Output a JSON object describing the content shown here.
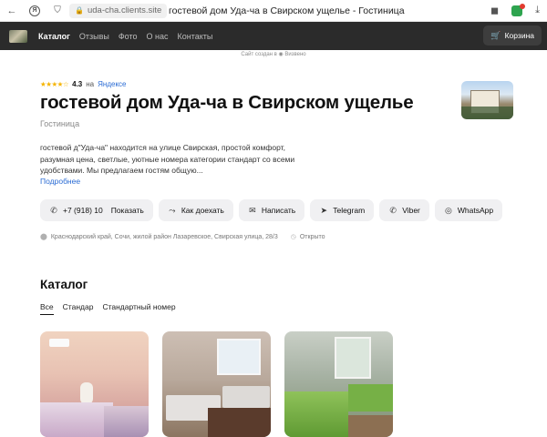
{
  "browser": {
    "url": "uda-cha.clients.site",
    "page_title": "гостевой дом Уда-ча в Свирском ущелье - Гостиница"
  },
  "nav": {
    "items": [
      {
        "label": "Каталог",
        "active": true
      },
      {
        "label": "Отзывы"
      },
      {
        "label": "Фото"
      },
      {
        "label": "О нас"
      },
      {
        "label": "Контакты"
      }
    ],
    "cart_label": "Корзина"
  },
  "made_with": "Сайт создан в ◉ Визвено",
  "business": {
    "rating": "4.3",
    "rating_on": "на",
    "rating_source": "Яндексе",
    "rating_stars": "★★★★☆",
    "name": "гостевой дом Уда-ча в Свирском ущелье",
    "category": "Гостиница",
    "description": "гостевой д\"Уда-ча\"  находится на улице Свирская, простой комфорт, разумная цена, светлые, уютные номера категории стандарт со всеми удобствами.  Мы  предлагаем  гостям  общую...",
    "more_label": "Подробнее"
  },
  "actions": {
    "phone": "+7 (918) 10",
    "show_label": "Показать",
    "route_label": "Как доехать",
    "write_label": "Написать",
    "telegram_label": "Telegram",
    "viber_label": "Viber",
    "whatsapp_label": "WhatsApp"
  },
  "address": {
    "text": "Краснодарский край, Сочи, жилой район Лазаревское, Свирская улица, 28/3",
    "status": "Открыто"
  },
  "catalog": {
    "title": "Каталог",
    "tabs": [
      "Все",
      "Стандар",
      "Стандaртный номер"
    ]
  },
  "colors": {
    "nav_bg": "#2b2b2b",
    "button_bg": "#f0f0f2",
    "link": "#2b6cd4",
    "star": "#f5b400"
  }
}
